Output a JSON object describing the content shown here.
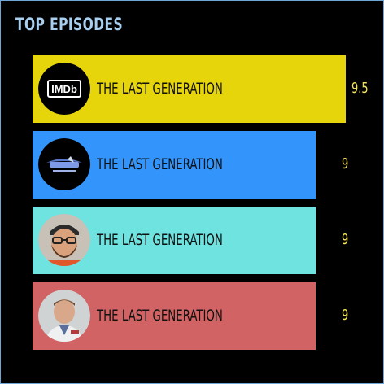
{
  "header": {
    "title": "TOP EPISODES"
  },
  "chart_data": {
    "type": "bar",
    "orientation": "horizontal",
    "title": "TOP EPISODES",
    "categories": [
      "THE LAST GENERATION",
      "THE LAST GENERATION",
      "THE LAST GENERATION",
      "THE LAST GENERATION"
    ],
    "values": [
      9.5,
      9,
      9,
      9
    ],
    "value_labels": [
      "9.5",
      "9",
      "9",
      "9"
    ],
    "bar_colors": [
      "#e6d50a",
      "#3394fb",
      "#6fe3e0",
      "#d26364"
    ],
    "icons": [
      "imdb-logo-icon",
      "star-trek-logo-icon",
      "avatar-bearded-man-icon",
      "avatar-man-icon"
    ],
    "imdb_text": "IMDb",
    "value_color": "#f2e35a",
    "grid": false,
    "legend": "none"
  }
}
